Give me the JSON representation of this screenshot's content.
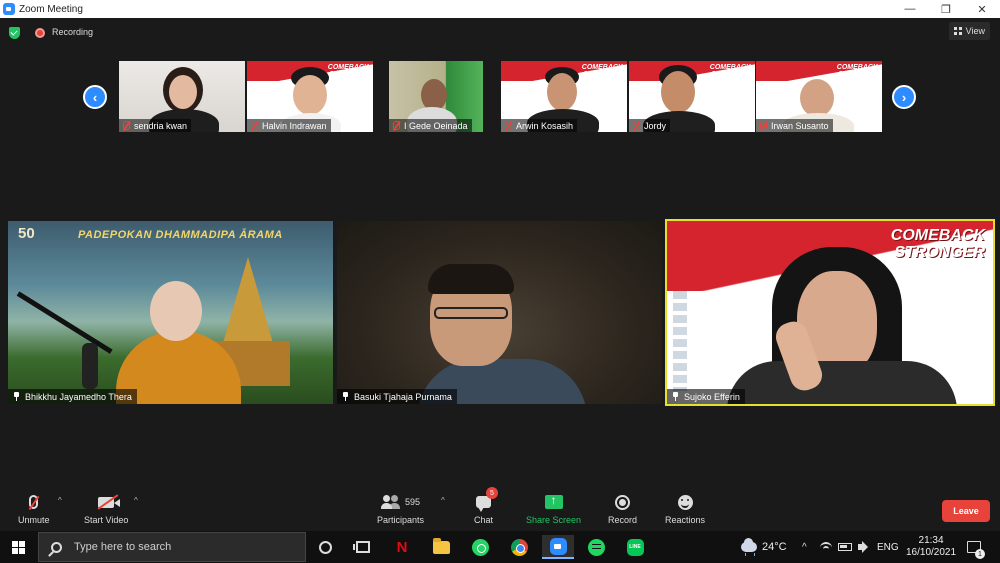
{
  "window": {
    "title": "Zoom Meeting",
    "controls": {
      "minimize": "—",
      "restore": "❐",
      "close": "✕"
    }
  },
  "status": {
    "recording_label": "Recording",
    "view_label": "View"
  },
  "thumbnails": [
    {
      "name": "sendria kwan",
      "muted": true,
      "bg": "plain"
    },
    {
      "name": "Halvin Indrawan",
      "muted": true,
      "bg": "banner"
    },
    {
      "name": "I Gede Oeinada",
      "muted": true,
      "bg": "green"
    },
    {
      "name": "Arwin Kosasih",
      "muted": true,
      "bg": "banner"
    },
    {
      "name": "Jordy",
      "muted": true,
      "bg": "banner"
    },
    {
      "name": "Irwan Susanto",
      "muted": true,
      "bg": "banner"
    }
  ],
  "thumbnail_banner_text": "COMEBACK STRONGER",
  "nav": {
    "prev": "‹",
    "next": "›"
  },
  "main_tiles": [
    {
      "name": "Bhikkhu Jayamedho Thera",
      "banner": "PADEPOKAN DHAMMADIPA ĀRAMA",
      "badge": "50"
    },
    {
      "name": "Basuki Tjahaja Purnama"
    },
    {
      "name": "Sujoko Efferin",
      "banner_line1": "COMEBACK",
      "banner_line2": "STRONGER",
      "active_speaker": true
    }
  ],
  "controls": {
    "unmute": "Unmute",
    "start_video": "Start Video",
    "participants": "Participants",
    "participants_count": "595",
    "chat": "Chat",
    "chat_badge": "5",
    "share_screen": "Share Screen",
    "record": "Record",
    "reactions": "Reactions",
    "leave": "Leave",
    "caret": "^"
  },
  "taskbar": {
    "search_placeholder": "Type here to search",
    "netflix_glyph": "N",
    "line_label": "LINE",
    "temperature": "24°C",
    "tray_chevron": "^",
    "language": "ENG",
    "time": "21:34",
    "date": "16/10/2021",
    "notification_count": "1"
  },
  "colors": {
    "accent": "#2d8cff",
    "leave": "#e8433a",
    "share": "#23c464",
    "active_speaker_border": "#e6e02a"
  }
}
